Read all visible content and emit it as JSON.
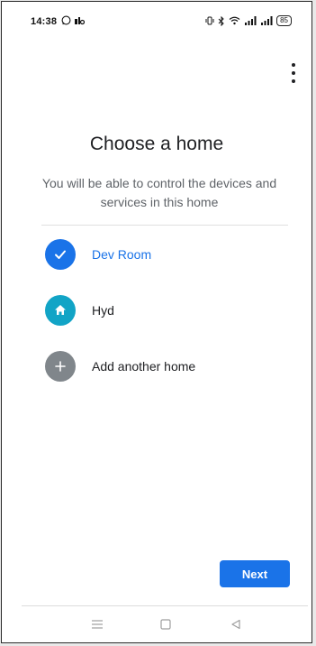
{
  "status_bar": {
    "time": "14:38",
    "left_icons": [
      "whatsapp-icon",
      "notification-icon"
    ],
    "right_icons": [
      "vibrate-icon",
      "bluetooth-icon",
      "wifi-icon",
      "signal-icon",
      "signal-icon"
    ],
    "battery": "85"
  },
  "header": {
    "title": "Choose a home",
    "subtitle": "You will be able to control the devices and services in this home"
  },
  "homes": [
    {
      "label": "Dev Room",
      "icon": "check-icon",
      "selected": true,
      "color": "#1a73e8"
    },
    {
      "label": "Hyd",
      "icon": "home-icon",
      "selected": false,
      "color": "#12a4c6"
    },
    {
      "label": "Add another home",
      "icon": "plus-icon",
      "selected": false,
      "color": "#80868b"
    }
  ],
  "actions": {
    "next_label": "Next"
  },
  "colors": {
    "accent": "#1a73e8",
    "home_teal": "#12a4c6",
    "add_gray": "#80868b"
  }
}
